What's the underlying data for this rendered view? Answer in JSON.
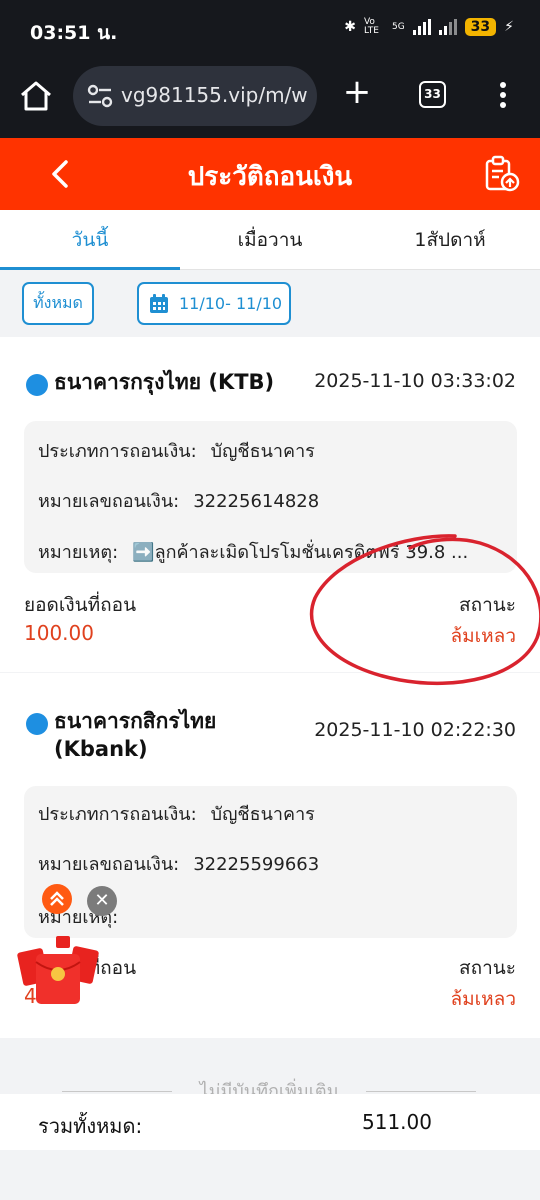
{
  "status_bar": {
    "time": "03:51 น.",
    "battery": "33",
    "network": "Vo LTE",
    "network_gen": "5G"
  },
  "browser": {
    "url": "vg981155.vip/m/w",
    "tab_count": "33"
  },
  "header": {
    "title": "ประวัติถอนเงิน"
  },
  "tabs": [
    {
      "label": "วันนี้",
      "active": true
    },
    {
      "label": "เมื่อวาน",
      "active": false
    },
    {
      "label": "1สัปดาห์",
      "active": false
    }
  ],
  "filters": {
    "all_label": "ทั้งหมด",
    "date_range": "11/10- 11/10"
  },
  "records": [
    {
      "bank_name": "ธนาคารกรุงไทย (KTB)",
      "datetime": "2025-11-10 03:33:02",
      "type_label": "ประเภทการถอนเงิน:",
      "type_value": "บัญชีธนาคาร",
      "number_label": "หมายเลขถอนเงิน:",
      "number_value": "32225614828",
      "note_label": "หมายเหตุ:",
      "note_value": "➡️ลูกค้าละเมิดโปรโมชั่นเครดิตฟรี 39.8 ...",
      "amount_label": "ยอดเงินที่ถอน",
      "amount_value": "100.00",
      "status_label": "สถานะ",
      "status_value": "ล้มเหลว"
    },
    {
      "bank_name_line1": "ธนาคารกสิกรไทย",
      "bank_name_line2": "(Kbank)",
      "datetime": "2025-11-10 02:22:30",
      "type_label": "ประเภทการถอนเงิน:",
      "type_value": "บัญชีธนาคาร",
      "number_label": "หมายเลขถอนเงิน:",
      "number_value": "32225599663",
      "note_label": "หมายเหตุ:",
      "amount_label": "ยอดเงินที่ถอน",
      "amount_value": "40.00",
      "status_label": "สถานะ",
      "status_value": "ล้มเหลว"
    }
  ],
  "footer": {
    "no_more": "ไม่มีบันทึกเพิ่มเติม",
    "total_label": "รวมทั้งหมด:",
    "total_value": "511.00"
  },
  "colors": {
    "header_bg": "#ff3300",
    "accent_blue": "#1f8fd2",
    "fail_red": "#e0411e",
    "annotation_red": "#d9232e"
  }
}
